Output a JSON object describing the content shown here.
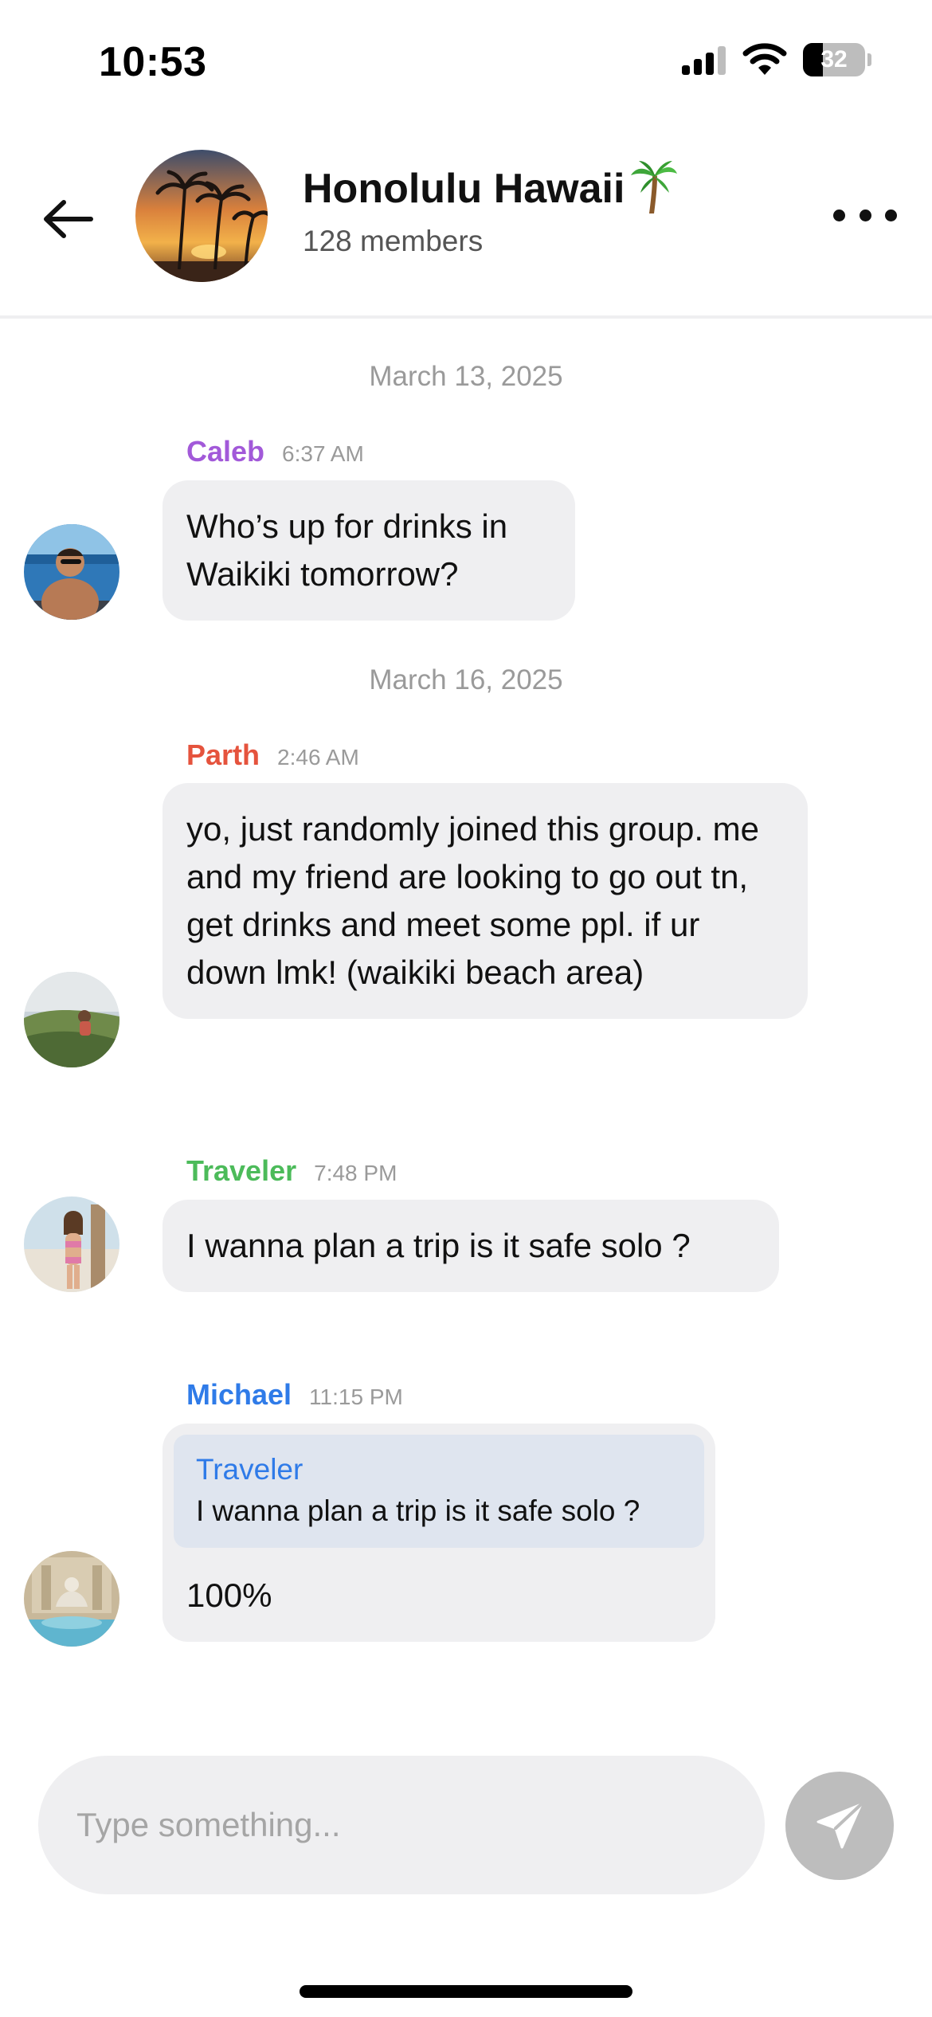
{
  "status_bar": {
    "time": "10:53",
    "battery_percent": "32",
    "battery_level": 0.32
  },
  "header": {
    "title": "Honolulu Hawaii",
    "members": "128 members"
  },
  "messages": [
    {
      "date": "March 13, 2025",
      "sender": "Caleb",
      "time": "6:37 AM",
      "sender_color": "#a259d9",
      "text": "Who’s up for drinks in Waikiki tomorrow?"
    },
    {
      "date": "March 16, 2025",
      "sender": "Parth",
      "time": "2:46 AM",
      "sender_color": "#e5533d",
      "text": "yo, just randomly joined this group. me and my friend are looking to go out tn, get drinks and meet some ppl. if ur down lmk! (waikiki beach area)"
    },
    {
      "sender": "Traveler",
      "time": "7:48 PM",
      "sender_color": "#4cbb5a",
      "text": "I wanna plan a trip is it safe solo ?"
    },
    {
      "sender": "Michael",
      "time": "11:15 PM",
      "sender_color": "#2f7be8",
      "reply_to": {
        "sender": "Traveler",
        "text": "I wanna plan a trip is it safe solo ?"
      },
      "text": "100%"
    }
  ],
  "composer": {
    "placeholder": "Type something..."
  },
  "icons": {
    "back": "arrow-left-icon",
    "more": "more-horizontal-icon",
    "send": "send-icon",
    "palm": "palm-tree-icon"
  },
  "colors": {
    "bubble_bg": "#efeff1",
    "reply_bg": "#dfe5ef",
    "send_disabled": "#bdbdbd"
  }
}
